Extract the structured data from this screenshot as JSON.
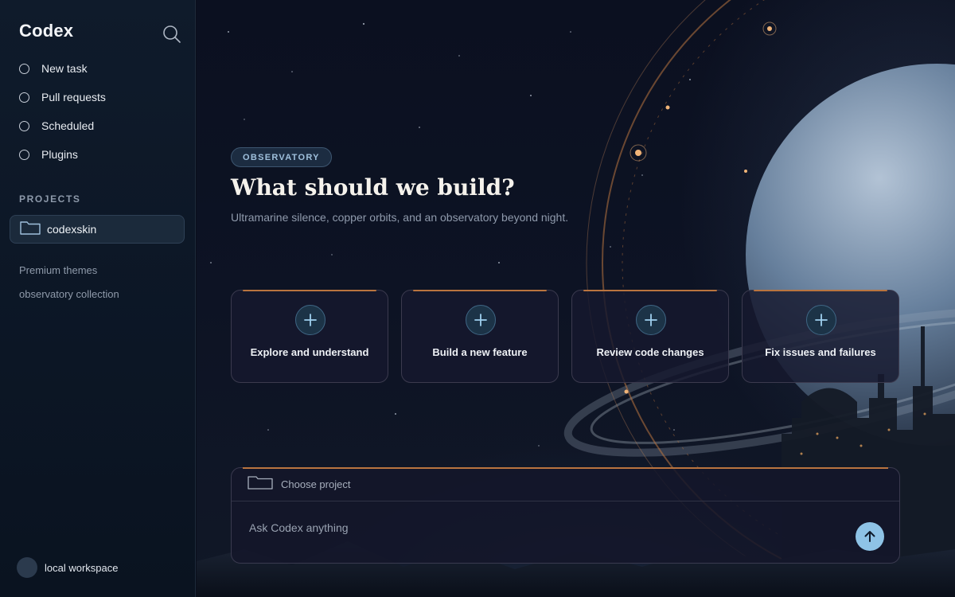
{
  "app": {
    "name": "Codex"
  },
  "sidebar": {
    "nav": [
      {
        "label": "New task"
      },
      {
        "label": "Pull requests"
      },
      {
        "label": "Scheduled"
      },
      {
        "label": "Plugins"
      }
    ],
    "projects_title": "PROJECTS",
    "projects": [
      {
        "label": "codexskin"
      }
    ],
    "links": [
      "Premium themes",
      "observatory collection"
    ],
    "workspace": {
      "label": "local workspace"
    }
  },
  "hero": {
    "badge": "OBSERVATORY",
    "title": "What should we build?",
    "subtitle": "Ultramarine silence, copper orbits, and an observatory beyond night."
  },
  "cards": [
    {
      "label": "Explore and understand",
      "icon": "plus-icon"
    },
    {
      "label": "Build a new feature",
      "icon": "plus-icon"
    },
    {
      "label": "Review code changes",
      "icon": "plus-icon"
    },
    {
      "label": "Fix issues and failures",
      "icon": "plus-icon"
    }
  ],
  "composer": {
    "project_label": "Choose project",
    "placeholder": "Ask Codex anything"
  },
  "colors": {
    "accent_copper": "#b9743f",
    "send_button": "#8ec3e6",
    "sidebar_bg": "#0f1b2b"
  }
}
